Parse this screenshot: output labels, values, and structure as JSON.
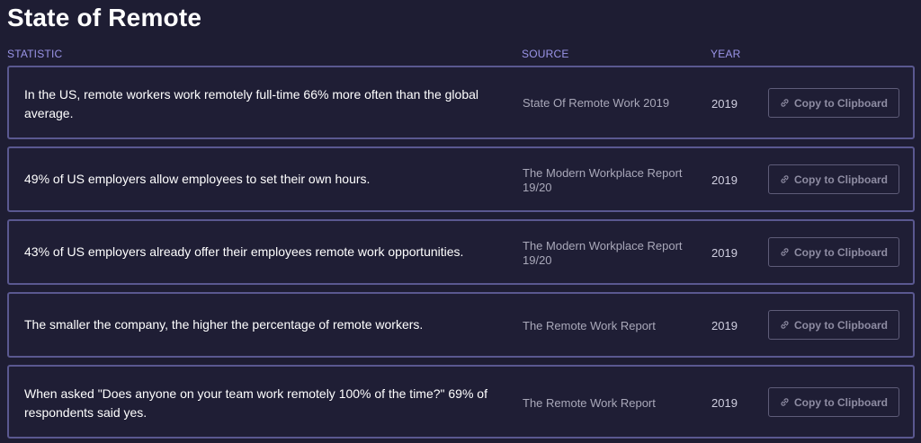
{
  "page": {
    "title": "State of Remote"
  },
  "columns": {
    "statistic": "STATISTIC",
    "source": "SOURCE",
    "year": "YEAR"
  },
  "rows": [
    {
      "statistic": "In the US, remote workers work remotely full-time 66% more often than the global average.",
      "source": "State Of Remote Work 2019",
      "year": "2019",
      "button": "Copy to Clipboard"
    },
    {
      "statistic": "49% of US employers allow employees to set their own hours.",
      "source": "The Modern Workplace Report 19/20",
      "year": "2019",
      "button": "Copy to Clipboard"
    },
    {
      "statistic": "43% of US employers already offer their employees remote work opportunities.",
      "source": "The Modern Workplace Report 19/20",
      "year": "2019",
      "button": "Copy to Clipboard"
    },
    {
      "statistic": "The smaller the company, the higher the percentage of remote workers.",
      "source": "The Remote Work Report",
      "year": "2019",
      "button": "Copy to Clipboard"
    },
    {
      "statistic": "When asked \"Does anyone on your team work remotely 100% of the time?\" 69% of respondents said yes.",
      "source": "The Remote Work Report",
      "year": "2019",
      "button": "Copy to Clipboard"
    }
  ],
  "icons": {
    "copy": "link-icon"
  },
  "colors": {
    "background": "#1e1d33",
    "row_border": "#5a5890",
    "header_accent": "#9b95e8",
    "button_border": "#5e5c78"
  }
}
